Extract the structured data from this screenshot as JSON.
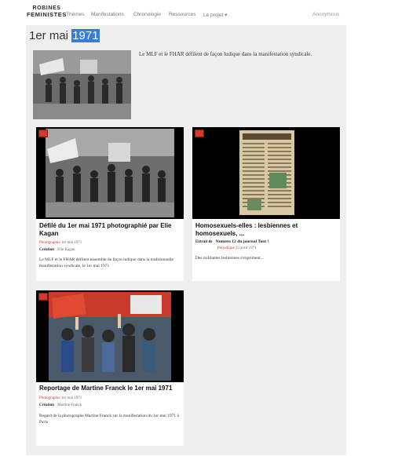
{
  "logo": {
    "line1": "ROBINES",
    "line2": "FEMINISTES"
  },
  "nav": {
    "items": [
      "Thèmes",
      "Manifestations",
      "Chronologie",
      "Ressources",
      "Le projet ▾"
    ],
    "user": "Anonymous"
  },
  "page": {
    "title_prefix": "1er mai",
    "title_highlight": "1971",
    "description": "Le MLF et le FHAR défilent de façon ludique dans la manifestation syndicale."
  },
  "cards": [
    {
      "title": "Défilé du 1er mai 1971 photographié par Elie Kagan",
      "type": "Photographie",
      "date": "1er mai 1971",
      "credit_label": "Création",
      "credit_value": "Elie Kagan",
      "description": "Le MLF et le FHAR défilent ensemble de façon ludique dans la traditionnelle manifestation syndicale, le 1er mai 1971"
    },
    {
      "title": "Homosexuels-elles : lesbiennes et homosexuels, ...",
      "extract_label": "Extrait de",
      "extract_value": "Numéro 12 du journal Tout !",
      "type": "Périodique",
      "date": "23 avril 1971",
      "description": "Des militantes lesbiennes s'expriment..."
    },
    {
      "title": "Reportage de Martine Franck le 1er mai 1971",
      "type": "Photographie",
      "date": "1er mai 1971",
      "credit_label": "Création",
      "credit_value": "Martine Franck",
      "description": "Regard de la photographe Martine Franck sur la manifestation du 1er mai 1971 à Paris"
    }
  ],
  "colors": {
    "accent": "#3a7bd5",
    "type_tag": "#c0392b",
    "flag": "#d43a2a",
    "background": "#efefef"
  }
}
